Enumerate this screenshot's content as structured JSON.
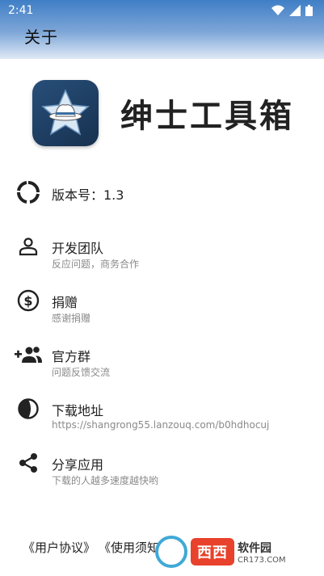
{
  "status": {
    "time": "2:41"
  },
  "appbar": {
    "title": "关于"
  },
  "app": {
    "name": "绅士工具箱"
  },
  "items": [
    {
      "title": "版本号：1.3",
      "subtitle": "",
      "icon": "circle-segments-icon"
    },
    {
      "title": "开发团队",
      "subtitle": "反应问题，商务合作",
      "icon": "person-icon"
    },
    {
      "title": "捐赠",
      "subtitle": "感谢捐赠",
      "icon": "dollar-icon"
    },
    {
      "title": "官方群",
      "subtitle": "问题反馈交流",
      "icon": "group-add-icon"
    },
    {
      "title": "下载地址",
      "subtitle": "https://shangrong55.lanzouq.com/b0hdhocuj",
      "icon": "contrast-icon"
    },
    {
      "title": "分享应用",
      "subtitle": "下载的人越多速度越快哟",
      "icon": "share-icon"
    }
  ],
  "footer": {
    "user_agreement": "《用户协议》",
    "usage_notice": "《使用须知"
  },
  "watermark": {
    "main": "西西",
    "side": "软件园",
    "url": "CR173.COM"
  },
  "colors": {
    "appbar_top": "#3f7ec6",
    "icon": "#222222",
    "subtitle": "#8a8a8a"
  }
}
